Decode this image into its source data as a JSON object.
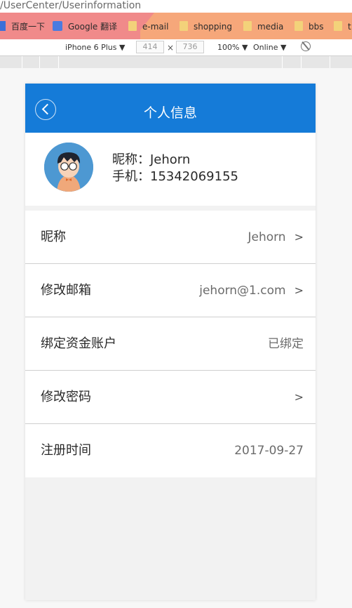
{
  "browser": {
    "url": "/UserCenter/Userinformation",
    "bookmarks": [
      "百度一下",
      "Google 翻译",
      "e-mail",
      "shopping",
      "media",
      "bbs",
      "t"
    ]
  },
  "device_toolbar": {
    "device": "iPhone 6 Plus ▼",
    "width": "414",
    "times": "×",
    "height": "736",
    "zoom": "100% ▼",
    "network": "Online ▼"
  },
  "page": {
    "title": "个人信息",
    "profile": {
      "nickname_line": "昵称：Jehorn",
      "phone_line": "手机：15342069155"
    },
    "rows": [
      {
        "label": "昵称",
        "value": "Jehorn",
        "chevron": ">"
      },
      {
        "label": "修改邮箱",
        "value": "jehorn@1.com",
        "chevron": ">"
      },
      {
        "label": "绑定资金账户",
        "value": "已绑定",
        "chevron": ""
      },
      {
        "label": "修改密码",
        "value": "",
        "chevron": ">"
      },
      {
        "label": "注册时间",
        "value": "2017-09-27",
        "chevron": ""
      }
    ]
  },
  "colors": {
    "header_blue": "#157bd8",
    "page_bg": "#f2f2f2"
  }
}
